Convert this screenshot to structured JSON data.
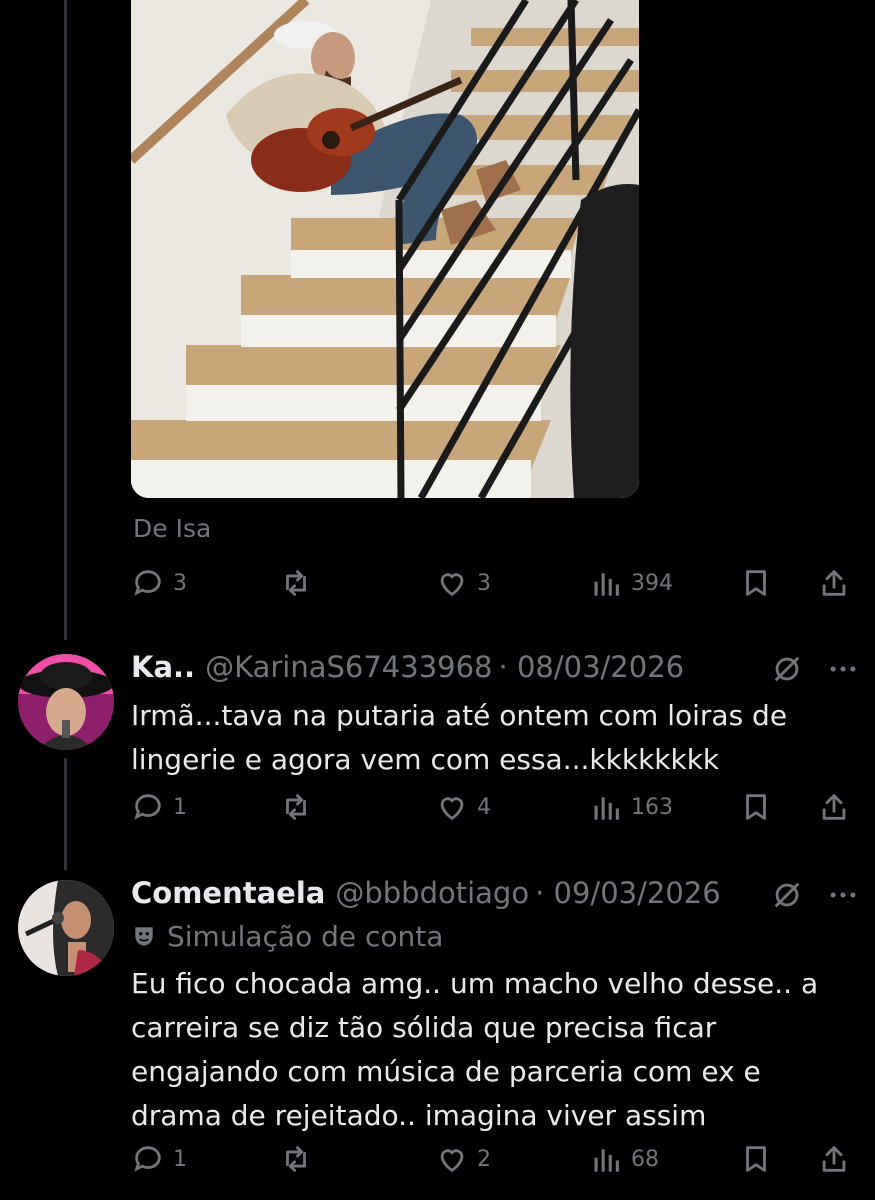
{
  "tweet_top": {
    "source_label": "De Isa",
    "replies": "3",
    "retweets": "",
    "likes": "3",
    "views": "394",
    "mute_icon": "muted-speaker-icon"
  },
  "replies": [
    {
      "display_name": "Ka..",
      "handle": "@KarinaS67433968",
      "date": "· 08/03/2026",
      "text": "Irmã...tava na putaria até ontem com loiras de lingerie e agora vem com essa...kkkkkkkk",
      "replies": "1",
      "likes": "4",
      "views": "163"
    },
    {
      "display_name": "Comentaela",
      "handle": "@bbbdotiago",
      "date": "· 09/03/2026",
      "badge": "Simulação de conta",
      "text": "Eu fico chocada amg.. um macho velho desse.. a carreira se diz tão sólida que precisa ficar engajando com música de parceria com ex e drama de rejeitado.. imagina viver assim",
      "replies": "1",
      "likes": "2",
      "views": "68"
    }
  ],
  "colors": {
    "background": "#000000",
    "text": "#e7e9ea",
    "muted": "#71767b",
    "thread_line": "#333639"
  }
}
